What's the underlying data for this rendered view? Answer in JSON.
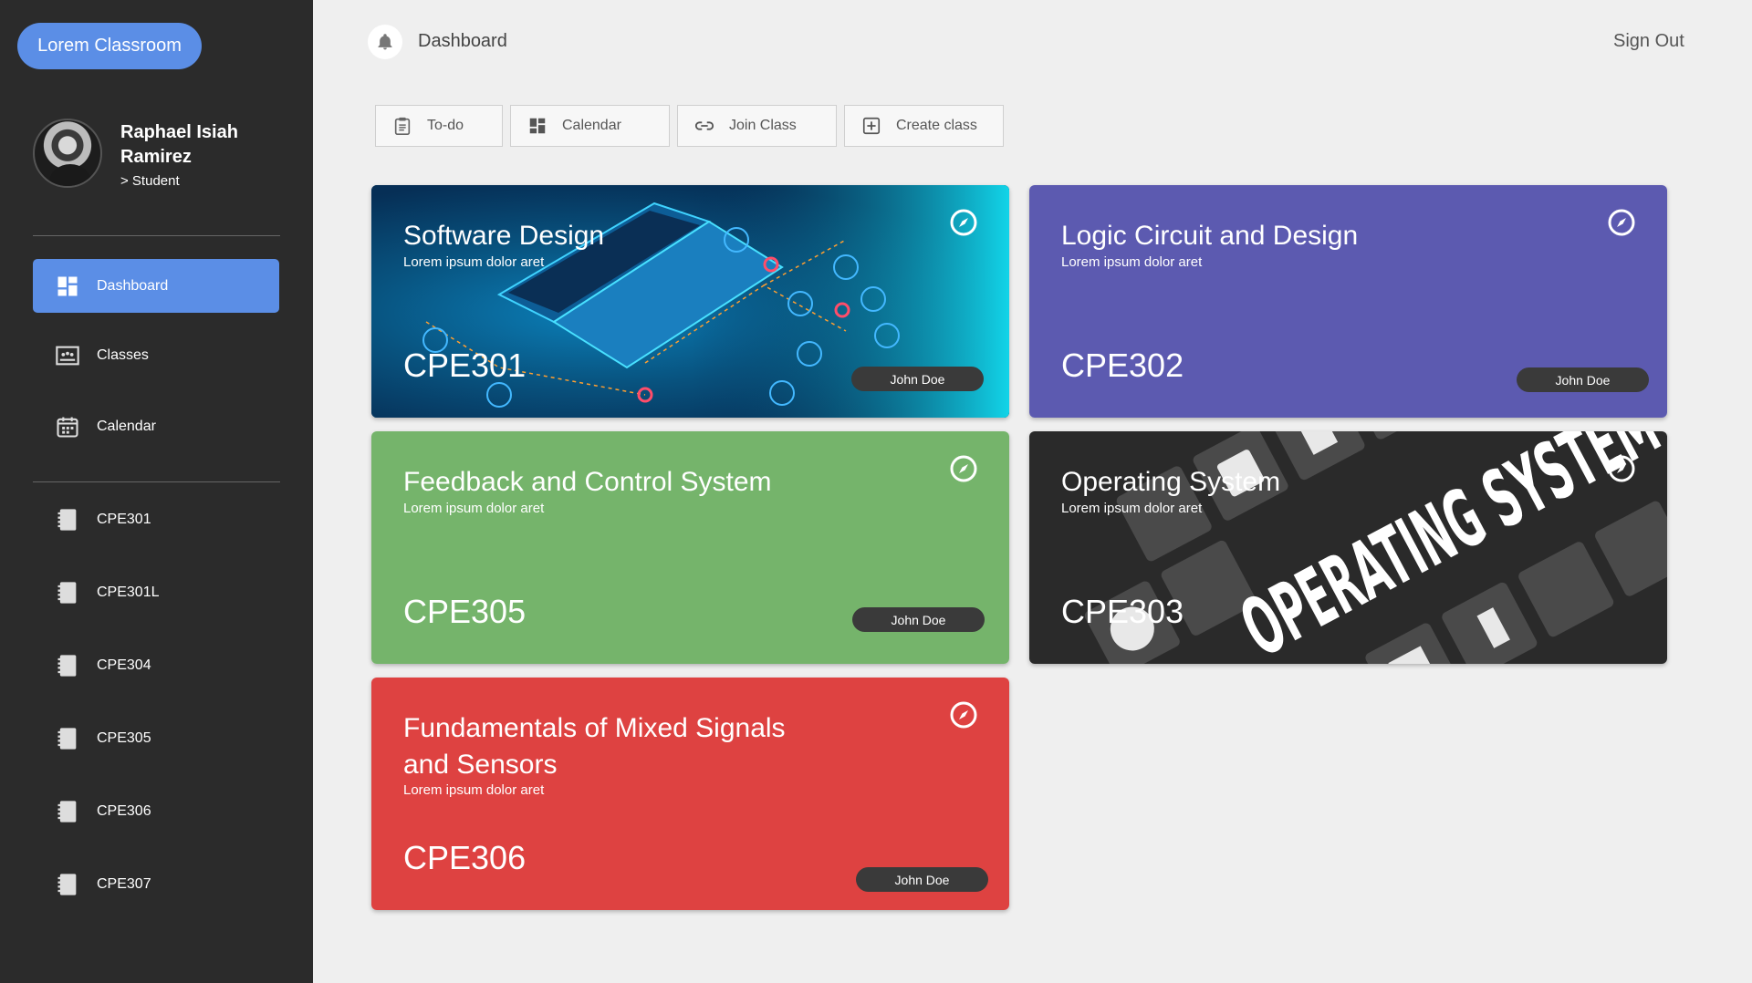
{
  "brand": "Lorem Classroom",
  "profile": {
    "name": "Raphael Isiah Ramirez",
    "role": "> Student"
  },
  "nav": [
    {
      "label": "Dashboard",
      "icon": "dashboard-icon",
      "active": true
    },
    {
      "label": "Classes",
      "icon": "classes-icon"
    },
    {
      "label": "Calendar",
      "icon": "calendar-icon"
    }
  ],
  "classes_nav": [
    "CPE301",
    "CPE301L",
    "CPE304",
    "CPE305",
    "CPE306",
    "CPE307"
  ],
  "header": {
    "title": "Dashboard",
    "signout": "Sign Out"
  },
  "toolbar": [
    {
      "label": "To-do",
      "icon": "clipboard-icon"
    },
    {
      "label": "Calendar",
      "icon": "grid-icon"
    },
    {
      "label": "Join Class",
      "icon": "link-icon"
    },
    {
      "label": "Create class",
      "icon": "add-box-icon"
    }
  ],
  "cards": [
    {
      "title": "Software Design",
      "subtitle": "Lorem ipsum dolor aret",
      "code": "CPE301",
      "teacher": "John Doe",
      "color": "#0a6fa6"
    },
    {
      "title": "Logic Circuit and Design",
      "subtitle": "Lorem ipsum dolor aret",
      "code": "CPE302",
      "teacher": "John Doe",
      "color": "#5c5ab0"
    },
    {
      "title": "Feedback and Control System",
      "subtitle": "Lorem ipsum dolor aret",
      "code": "CPE305",
      "teacher": "John Doe",
      "color": "#75b46b"
    },
    {
      "title": "Operating System",
      "subtitle": "Lorem ipsum dolor aret",
      "code": "CPE303",
      "teacher": "",
      "color": "#2a2a2a",
      "banner": "OPERATING SYSTEM"
    },
    {
      "title": "Fundamentals of Mixed Signals and Sensors",
      "subtitle": "Lorem ipsum dolor aret",
      "code": "CPE306",
      "teacher": "John Doe",
      "color": "#de4241"
    }
  ],
  "colors": {
    "sidebar": "#2b2b2b",
    "accent": "#5b8ee6",
    "page": "#efefef"
  }
}
